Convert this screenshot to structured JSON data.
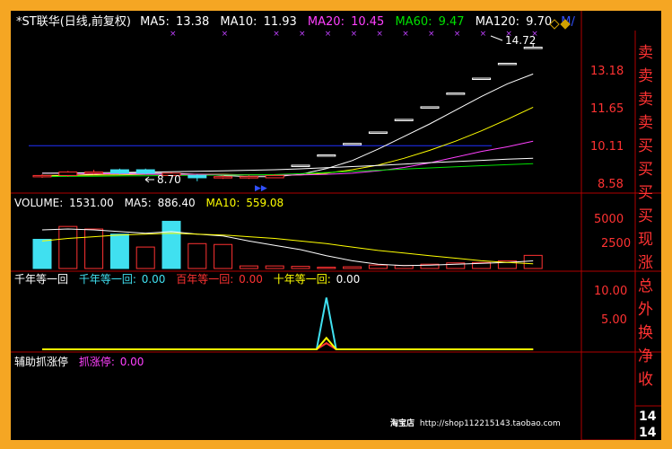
{
  "header": {
    "title": "*ST联华(日线,前复权)",
    "ma5_label": "MA5:",
    "ma5_value": "13.38",
    "ma10_label": "MA10:",
    "ma10_value": "11.93",
    "ma20_label": "MA20:",
    "ma20_value": "10.45",
    "ma60_label": "MA60:",
    "ma60_value": "9.47",
    "ma120_label": "MA120:",
    "ma120_value": "9.70",
    "extra": "M/"
  },
  "price_panel": {
    "high_label": "14.72",
    "low_label": "8.70",
    "axis_ticks": [
      "13.18",
      "11.65",
      "10.11",
      "8.58"
    ]
  },
  "volume_panel": {
    "label": "VOLUME:",
    "value": "1531.00",
    "ma5_label": "MA5:",
    "ma5_value": "886.40",
    "ma10_label": "MA10:",
    "ma10_value": "559.08",
    "axis_ticks": [
      "5000",
      "2500"
    ]
  },
  "indicator_panel": {
    "title": "千年等一回",
    "items": [
      {
        "label": "千年等一回:",
        "value": "0.00"
      },
      {
        "label": "百年等一回:",
        "value": "0.00"
      },
      {
        "label": "十年等一回:",
        "value": "0.00"
      }
    ],
    "axis_ticks": [
      "10.00",
      "5.00"
    ]
  },
  "aux_panel": {
    "title": "辅助抓涨停",
    "label": "抓涨停:",
    "value": "0.00"
  },
  "side_panel": {
    "items": [
      "卖",
      "卖",
      "卖",
      "卖",
      "买",
      "买",
      "买",
      "买",
      "现",
      "涨",
      "总",
      "外",
      "换",
      "净",
      "收"
    ],
    "bottom": [
      "14",
      "14"
    ]
  },
  "watermark": {
    "shop": "淘宝店",
    "url": "http://shop112215143.taobao.com"
  },
  "colors": {
    "background": "#000000",
    "frame": "#f5a623",
    "grid": "#b00000",
    "up": "#ff3232",
    "down": "#40e0f0",
    "ma5": "#ffffff",
    "ma10": "#ffff00",
    "ma20": "#ff40ff",
    "ma60": "#00e000",
    "ma120": "#ffffff"
  },
  "chart_data": [
    {
      "type": "candlestick",
      "title": "*ST联华(日线,前复权)",
      "ylim": [
        8.3,
        15.2
      ],
      "y_ticks": [
        13.18,
        11.65,
        10.11,
        8.58
      ],
      "candles": [
        {
          "o": 8.9,
          "c": 8.95,
          "h": 9.0,
          "l": 8.85,
          "dir": "up"
        },
        {
          "o": 8.95,
          "c": 9.1,
          "h": 9.15,
          "l": 8.9,
          "dir": "up"
        },
        {
          "o": 9.1,
          "c": 9.05,
          "h": 9.2,
          "l": 9.0,
          "dir": "up"
        },
        {
          "o": 9.05,
          "c": 9.2,
          "h": 9.25,
          "l": 9.0,
          "dir": "down"
        },
        {
          "o": 9.2,
          "c": 9.05,
          "h": 9.25,
          "l": 9.0,
          "dir": "down"
        },
        {
          "o": 9.05,
          "c": 8.95,
          "h": 9.1,
          "l": 8.9,
          "dir": "up"
        },
        {
          "o": 8.95,
          "c": 8.85,
          "h": 9.0,
          "l": 8.7,
          "dir": "down"
        },
        {
          "o": 8.85,
          "c": 8.9,
          "h": 8.95,
          "l": 8.8,
          "dir": "up"
        },
        {
          "o": 8.9,
          "c": 8.85,
          "h": 8.95,
          "l": 8.8,
          "dir": "up"
        },
        {
          "o": 8.85,
          "c": 8.95,
          "h": 9.0,
          "l": 8.85,
          "dir": "up"
        },
        {
          "o": 9.4,
          "c": 9.4,
          "h": 9.4,
          "l": 9.4,
          "dir": "limit"
        },
        {
          "o": 9.85,
          "c": 9.85,
          "h": 9.85,
          "l": 9.85,
          "dir": "limit"
        },
        {
          "o": 10.35,
          "c": 10.35,
          "h": 10.35,
          "l": 10.35,
          "dir": "limit"
        },
        {
          "o": 10.85,
          "c": 10.85,
          "h": 10.85,
          "l": 10.85,
          "dir": "limit"
        },
        {
          "o": 11.4,
          "c": 11.4,
          "h": 11.4,
          "l": 11.4,
          "dir": "limit"
        },
        {
          "o": 11.95,
          "c": 11.95,
          "h": 11.95,
          "l": 11.95,
          "dir": "limit"
        },
        {
          "o": 12.55,
          "c": 12.55,
          "h": 12.55,
          "l": 12.55,
          "dir": "limit"
        },
        {
          "o": 13.2,
          "c": 13.2,
          "h": 13.2,
          "l": 13.2,
          "dir": "limit"
        },
        {
          "o": 13.85,
          "c": 13.85,
          "h": 13.85,
          "l": 13.85,
          "dir": "limit"
        },
        {
          "o": 14.55,
          "c": 14.55,
          "h": 14.72,
          "l": 14.55,
          "dir": "limit"
        }
      ],
      "series": [
        {
          "name": "MA5",
          "values": [
            8.9,
            8.95,
            9.0,
            9.05,
            9.05,
            9.05,
            9.0,
            8.95,
            8.9,
            8.9,
            9.0,
            9.25,
            9.6,
            10.1,
            10.65,
            11.2,
            11.8,
            12.4,
            12.95,
            13.38
          ]
        },
        {
          "name": "MA10",
          "values": [
            8.95,
            8.95,
            8.97,
            8.98,
            9.0,
            9.0,
            9.0,
            9.0,
            8.98,
            8.97,
            8.98,
            9.05,
            9.2,
            9.4,
            9.7,
            10.05,
            10.45,
            10.9,
            11.4,
            11.93
          ]
        },
        {
          "name": "MA20",
          "values": [
            9.05,
            9.04,
            9.03,
            9.02,
            9.01,
            9.0,
            9.0,
            8.99,
            8.98,
            8.97,
            8.98,
            9.0,
            9.05,
            9.15,
            9.3,
            9.5,
            9.75,
            10.0,
            10.2,
            10.45
          ]
        },
        {
          "name": "MA60",
          "values": [
            8.9,
            8.91,
            8.92,
            8.93,
            8.94,
            8.95,
            8.96,
            8.97,
            8.98,
            8.99,
            9.03,
            9.08,
            9.13,
            9.18,
            9.23,
            9.28,
            9.33,
            9.38,
            9.42,
            9.47
          ]
        },
        {
          "name": "MA120",
          "values": [
            9.05,
            9.06,
            9.07,
            9.08,
            9.1,
            9.11,
            9.13,
            9.15,
            9.18,
            9.2,
            9.24,
            9.29,
            9.34,
            9.39,
            9.45,
            9.51,
            9.56,
            9.61,
            9.66,
            9.7
          ]
        }
      ],
      "reference_line": 10.25
    },
    {
      "type": "bar",
      "title": "VOLUME",
      "ylim": [
        0,
        6800
      ],
      "y_ticks": [
        5000,
        2500
      ],
      "values": [
        3400,
        4900,
        4600,
        4000,
        2500,
        5500,
        2900,
        2800,
        300,
        300,
        250,
        150,
        200,
        400,
        350,
        500,
        650,
        700,
        900,
        1531
      ],
      "dirs": [
        "down",
        "up",
        "up",
        "down",
        "up",
        "down",
        "up",
        "up",
        "up",
        "up",
        "up",
        "up",
        "up",
        "up",
        "up",
        "up",
        "up",
        "up",
        "up",
        "up"
      ],
      "series": [
        {
          "name": "MA5",
          "values": [
            4500,
            4600,
            4500,
            4300,
            4100,
            4300,
            4000,
            3800,
            3200,
            2700,
            2200,
            1500,
            900,
            500,
            350,
            400,
            500,
            600,
            700,
            886.4
          ]
        },
        {
          "name": "MA10",
          "values": [
            3200,
            3500,
            3700,
            3900,
            4000,
            4100,
            4000,
            3900,
            3700,
            3500,
            3200,
            2900,
            2500,
            2100,
            1800,
            1500,
            1200,
            900,
            700,
            559.08
          ]
        }
      ]
    },
    {
      "type": "line",
      "title": "千年等一回",
      "ylim": [
        0,
        12.5
      ],
      "y_ticks": [
        10.0,
        5.0
      ],
      "series": [
        {
          "name": "千年等一回",
          "values": [
            0,
            0,
            0,
            0,
            0,
            0,
            0,
            0,
            0,
            0,
            0,
            10,
            0,
            0,
            0,
            0,
            0,
            0,
            0,
            0
          ]
        },
        {
          "name": "百年等一回",
          "values": [
            0,
            0,
            0,
            0,
            0,
            0,
            0,
            0,
            0,
            0,
            0,
            1.2,
            0,
            0,
            0,
            0,
            0,
            0,
            0,
            0
          ]
        },
        {
          "name": "十年等一回",
          "values": [
            0,
            0,
            0,
            0,
            0,
            0,
            0,
            0,
            0,
            0,
            0,
            2.2,
            0,
            0,
            0,
            0,
            0,
            0,
            0,
            0
          ]
        }
      ]
    }
  ]
}
